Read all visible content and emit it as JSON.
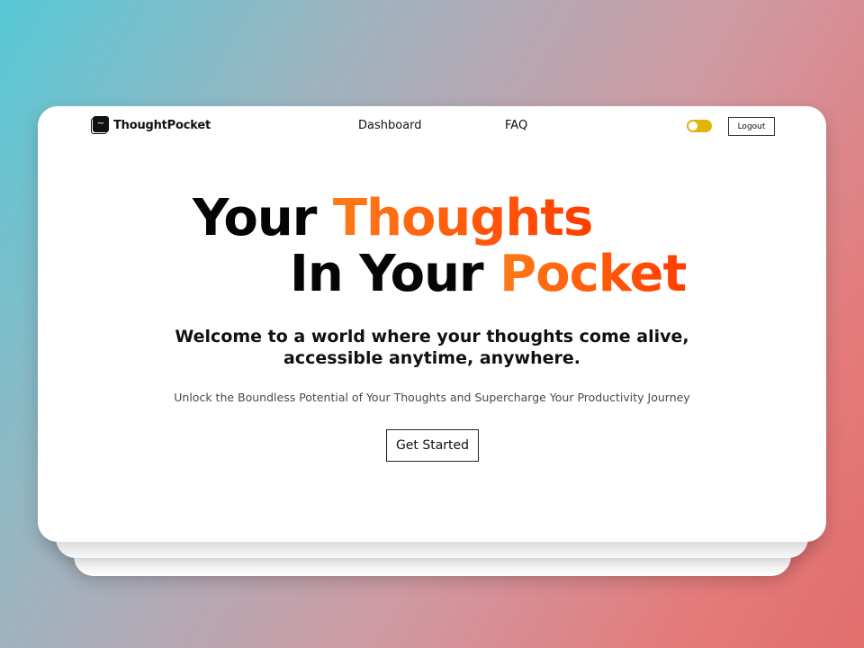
{
  "brand": {
    "name": "ThoughtPocket",
    "icon": "notebook-icon",
    "icon_glyph": "~"
  },
  "nav": {
    "items": [
      {
        "label": "Dashboard"
      },
      {
        "label": "FAQ"
      }
    ]
  },
  "header": {
    "theme_toggle": {
      "state": "on",
      "color": "#e2b30d"
    },
    "logout_label": "Logout"
  },
  "hero": {
    "line1": {
      "plain": "Your ",
      "accent": "Thoughts"
    },
    "line2": {
      "plain": "In Your ",
      "accent": "Pocket"
    },
    "welcome_line1": "Welcome to a world where your thoughts come alive,",
    "welcome_line2": "accessible anytime, anywhere.",
    "tagline": "Unlock the Boundless Potential of Your Thoughts and Supercharge Your Productivity Journey",
    "cta_label": "Get Started"
  },
  "colors": {
    "accent_start": "#ff7a18",
    "accent_end": "#ff3d00",
    "text": "#050505",
    "card": "#ffffff"
  }
}
